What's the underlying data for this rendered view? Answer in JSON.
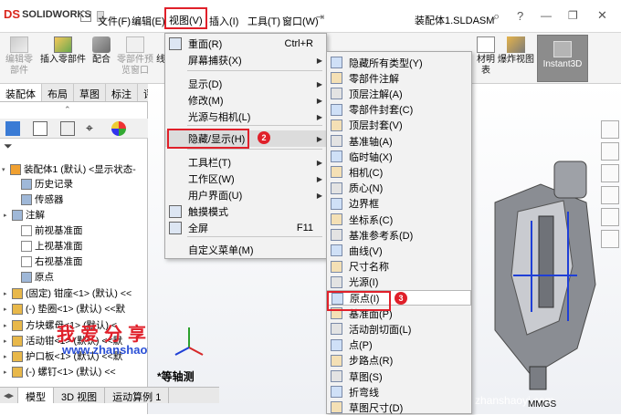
{
  "app": {
    "logo_prefix": "DS",
    "logo_text": "SOLIDWORKS"
  },
  "menubar": [
    "文件(F)",
    "编辑(E)",
    "视图(V)",
    "插入(I)",
    "工具(T)",
    "窗口(W)"
  ],
  "document_title": "装配体1.SLDASM",
  "toolbar": {
    "buttons": [
      {
        "label1": "编辑零",
        "label2": "部件",
        "disabled": true
      },
      {
        "label1": "插入零部件",
        "label2": "",
        "disabled": false
      },
      {
        "label1": "配合",
        "label2": "",
        "disabled": false
      },
      {
        "label1": "零部件预",
        "label2": "览窗口",
        "disabled": true
      },
      {
        "label1": "线",
        "label2": "",
        "disabled": false
      }
    ],
    "right_buttons": [
      {
        "label1": "材明",
        "label2": "表"
      },
      {
        "label1": "爆炸视图",
        "label2": ""
      }
    ],
    "instant3d": "Instant3D"
  },
  "command_tabs": [
    "装配体",
    "布局",
    "草图",
    "标注",
    "评"
  ],
  "tree": {
    "filter_icon": "funnel-icon",
    "items": [
      {
        "label": "装配体1 (默认) <显示状态-",
        "arrow": "▾",
        "indent": 2
      },
      {
        "label": "历史记录",
        "arrow": "",
        "indent": 14
      },
      {
        "label": "传感器",
        "arrow": "",
        "indent": 14
      },
      {
        "label": "注解",
        "arrow": "▸",
        "indent": 4
      },
      {
        "label": "前视基准面",
        "arrow": "",
        "indent": 14
      },
      {
        "label": "上视基准面",
        "arrow": "",
        "indent": 14
      },
      {
        "label": "右视基准面",
        "arrow": "",
        "indent": 14
      },
      {
        "label": "原点",
        "arrow": "",
        "indent": 14
      },
      {
        "label": "(固定) 钳座<1> (默认) <<",
        "arrow": "▸",
        "indent": 4
      },
      {
        "label": "(-) 垫圈<1> (默认) <<默",
        "arrow": "▸",
        "indent": 4
      },
      {
        "label": "方块螺母<1> (默认) <",
        "arrow": "▸",
        "indent": 4
      },
      {
        "label": "活动钳<1> (默认) <<默",
        "arrow": "▸",
        "indent": 4
      },
      {
        "label": "护口板<1> (默认) <<默",
        "arrow": "▸",
        "indent": 4
      },
      {
        "label": "(-) 螺钉<1> (默认) <<",
        "arrow": "▸",
        "indent": 4
      }
    ]
  },
  "bottom_tabs": [
    "模型",
    "3D 视图",
    "运动算例 1"
  ],
  "viewport": {
    "view_label": "*等轴测",
    "units": "MMGS"
  },
  "watermark": {
    "cn": "我爱分享网",
    "url": "www.zhanshaoyi.com",
    "url2": "zhanshaoyi.com"
  },
  "view_menu": {
    "items": [
      {
        "label": "重面(R)",
        "shortcut": "Ctrl+R",
        "arrow": false,
        "icon": "redraw-icon"
      },
      {
        "label": "屏幕捕获(X)",
        "shortcut": "",
        "arrow": true,
        "icon": ""
      },
      {
        "label": "显示(D)",
        "shortcut": "",
        "arrow": true,
        "icon": ""
      },
      {
        "label": "修改(M)",
        "shortcut": "",
        "arrow": true,
        "icon": ""
      },
      {
        "label": "光源与相机(L)",
        "shortcut": "",
        "arrow": true,
        "icon": ""
      },
      {
        "label": "隐藏/显示(H)",
        "shortcut": "",
        "arrow": true,
        "icon": ""
      },
      {
        "label": "工具栏(T)",
        "shortcut": "",
        "arrow": true,
        "icon": ""
      },
      {
        "label": "工作区(W)",
        "shortcut": "",
        "arrow": true,
        "icon": ""
      },
      {
        "label": "用户界面(U)",
        "shortcut": "",
        "arrow": true,
        "icon": ""
      },
      {
        "label": "触摸模式",
        "shortcut": "",
        "arrow": false,
        "icon": "hand-icon"
      },
      {
        "label": "全屏",
        "shortcut": "F11",
        "arrow": false,
        "icon": "fullscreen-icon"
      },
      {
        "label": "自定义菜单(M)",
        "shortcut": "",
        "arrow": false,
        "icon": ""
      }
    ]
  },
  "hideshow_menu": {
    "items": [
      "隐藏所有类型(Y)",
      "零部件注解",
      "顶层注解(A)",
      "零部件封套(C)",
      "顶层封套(V)",
      "基准轴(A)",
      "临时轴(X)",
      "相机(C)",
      "质心(N)",
      "边界框",
      "坐标系(C)",
      "基准参考系(D)",
      "曲线(V)",
      "尺寸名称",
      "光源(I)",
      "原点(I)",
      "基准面(P)",
      "活动剖切面(L)",
      "点(P)",
      "步路点(R)",
      "草图(S)",
      "折弯线",
      "草图尺寸(D)"
    ]
  },
  "badges": [
    "1",
    "2",
    "3"
  ],
  "colors": {
    "highlight": "#e0202a",
    "accent_blue": "#2a4fd6",
    "menu_bg": "#f2f2f2"
  }
}
